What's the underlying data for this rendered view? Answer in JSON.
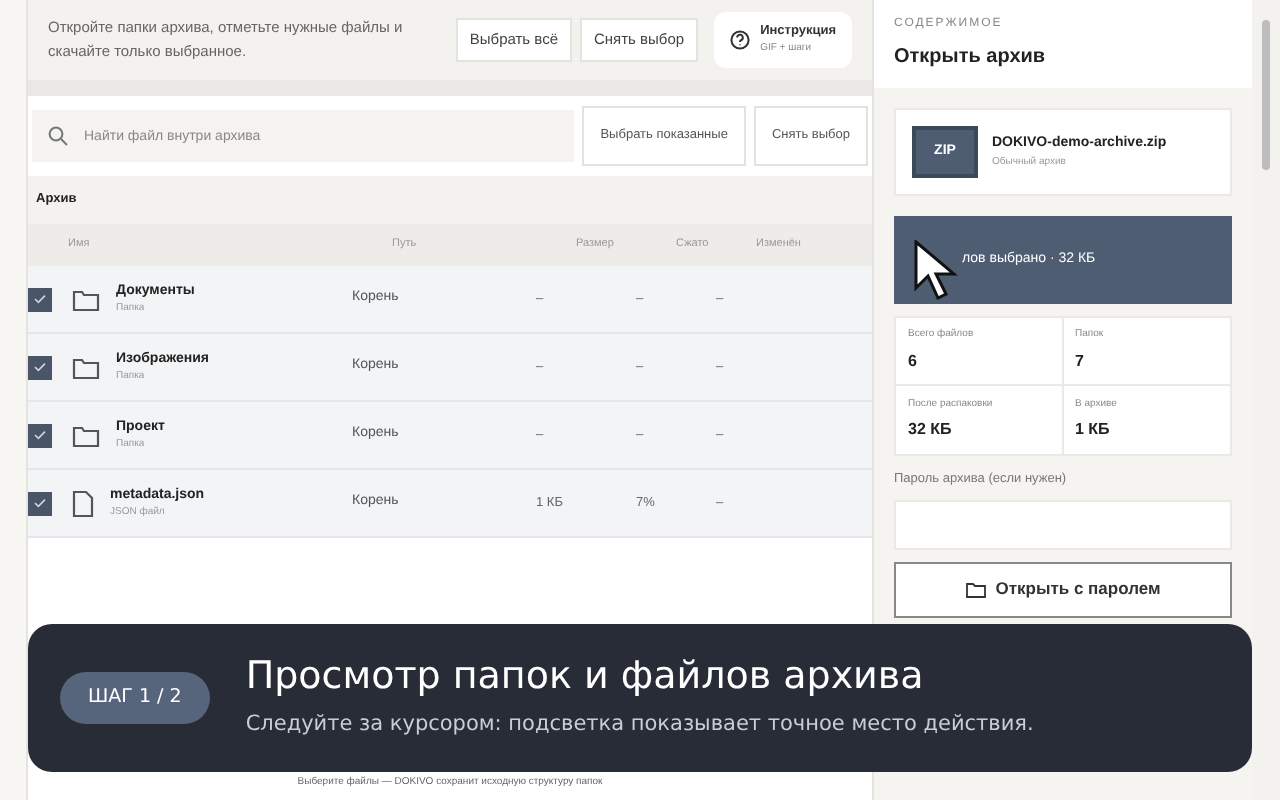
{
  "intro": {
    "text": "Откройте папки архива, отметьте нужные файлы и скачайте только выбранное.",
    "buttons": [
      "Выбрать всё",
      "Снять выбор"
    ],
    "help": {
      "title": "Инструкция",
      "subtitle": "GIF + шаги"
    }
  },
  "search": {
    "placeholder": "Найти файл внутри архива",
    "buttons": [
      "Выбрать показанные",
      "Снять выбор"
    ]
  },
  "table": {
    "title": "Архив",
    "columns": [
      "Имя",
      "Путь",
      "Размер",
      "Сжато",
      "Изменён"
    ],
    "rows": [
      {
        "kind": "folder",
        "name": "Документы",
        "type": "Папка",
        "path": "Корень",
        "size": "–",
        "compressed": "–",
        "modified": "–",
        "checked": true
      },
      {
        "kind": "folder",
        "name": "Изображения",
        "type": "Папка",
        "path": "Корень",
        "size": "–",
        "compressed": "–",
        "modified": "–",
        "checked": true
      },
      {
        "kind": "folder",
        "name": "Проект",
        "type": "Папка",
        "path": "Корень",
        "size": "–",
        "compressed": "–",
        "modified": "–",
        "checked": true
      },
      {
        "kind": "file",
        "name": "metadata.json",
        "type": "JSON файл",
        "path": "Корень",
        "size": "1 КБ",
        "compressed": "7%",
        "modified": "–",
        "checked": true
      }
    ]
  },
  "footer_note": "Выберите файлы — DOKIVO сохранит исходную структуру папок",
  "panel": {
    "eyebrow": "СОДЕРЖИМОЕ",
    "title": "Открыть архив",
    "archive": {
      "badge": "ZIP",
      "name": "DOKIVO-demo-archive.zip",
      "type": "Обычный архив"
    },
    "selection": "лов выбрано · 32 КБ",
    "stats": [
      {
        "label": "Всего файлов",
        "value": "6"
      },
      {
        "label": "Папок",
        "value": "7"
      },
      {
        "label": "После распаковки",
        "value": "32 КБ"
      },
      {
        "label": "В архиве",
        "value": "1 КБ"
      }
    ],
    "password_label": "Пароль архива (если нужен)",
    "open_button": "Открыть с паролем"
  },
  "tour": {
    "step": "ШАГ 1 / 2",
    "title": "Просмотр папок и файлов архива",
    "text": "Следуйте за курсором: подсветка показывает точное место действия."
  }
}
